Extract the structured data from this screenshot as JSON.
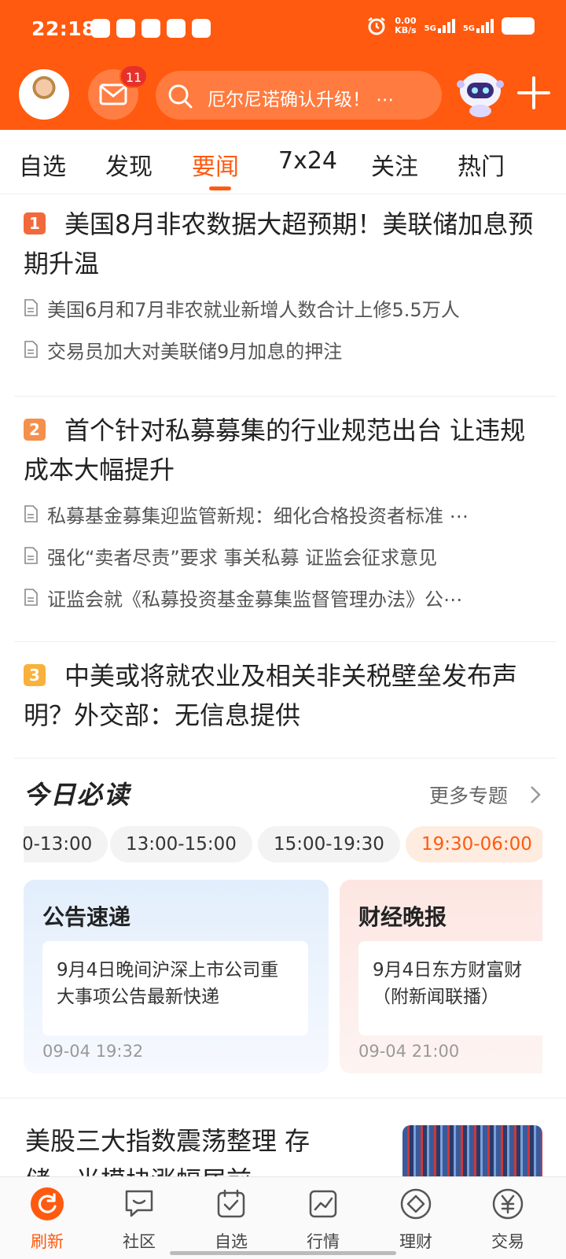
{
  "status_bar": {
    "time": "22:18",
    "net_speed_value": "0.00",
    "net_speed_unit": "KB/s",
    "signal1": "5G",
    "signal2": "5G"
  },
  "header": {
    "mail_badge": "11",
    "search_placeholder": "厄尔尼诺确认升级！ ⋯",
    "accent_color": "#ff5a0f"
  },
  "tabs": [
    {
      "label": "自选"
    },
    {
      "label": "发现"
    },
    {
      "label": "要闻",
      "active": true
    },
    {
      "label": "7x24"
    },
    {
      "label": "关注"
    },
    {
      "label": "热门"
    }
  ],
  "news": [
    {
      "rank": "1",
      "headline": "美国8月非农数据大超预期！美联储加息预期升温",
      "subs": [
        "美国6月和7月非农就业新增人数合计上修5.5万人",
        "交易员加大对美联储9月加息的押注"
      ]
    },
    {
      "rank": "2",
      "headline": "首个针对私募募集的行业规范出台 让违规成本大幅提升",
      "subs": [
        "私募基金募集迎监管新规：细化合格投资者标准 ⋯",
        "强化“卖者尽责”要求 事关私募 证监会征求意见",
        "证监会就《私募投资基金募集监督管理办法》公⋯"
      ]
    },
    {
      "rank": "3",
      "headline": "中美或将就农业及相关非关税壁垒发布声明？外交部：无信息提供",
      "subs": []
    }
  ],
  "must_read": {
    "title": "今日必读",
    "more": "更多专题",
    "slots": [
      {
        "label": "0-13:00"
      },
      {
        "label": "13:00-15:00"
      },
      {
        "label": "15:00-19:30"
      },
      {
        "label": "19:30-06:00",
        "active": true
      }
    ],
    "cards": [
      {
        "title": "公告速递",
        "body": "9月4日晚间沪深上市公司重大事项公告最新快递",
        "time": "09-04 19:32"
      },
      {
        "title": "财经晚报",
        "body": "9月4日东方财富财\n（附新闻联播）",
        "time": "09-04 21:00"
      }
    ]
  },
  "last_item": {
    "headline": "美股三大指数震荡整理 存储、光模块涨幅居前"
  },
  "bottom_nav": [
    {
      "label": "刷新",
      "icon": "refresh-icon",
      "active": true
    },
    {
      "label": "社区",
      "icon": "community-icon"
    },
    {
      "label": "自选",
      "icon": "watchlist-icon"
    },
    {
      "label": "行情",
      "icon": "market-icon"
    },
    {
      "label": "理财",
      "icon": "wealth-icon"
    },
    {
      "label": "交易",
      "icon": "trade-icon"
    }
  ]
}
